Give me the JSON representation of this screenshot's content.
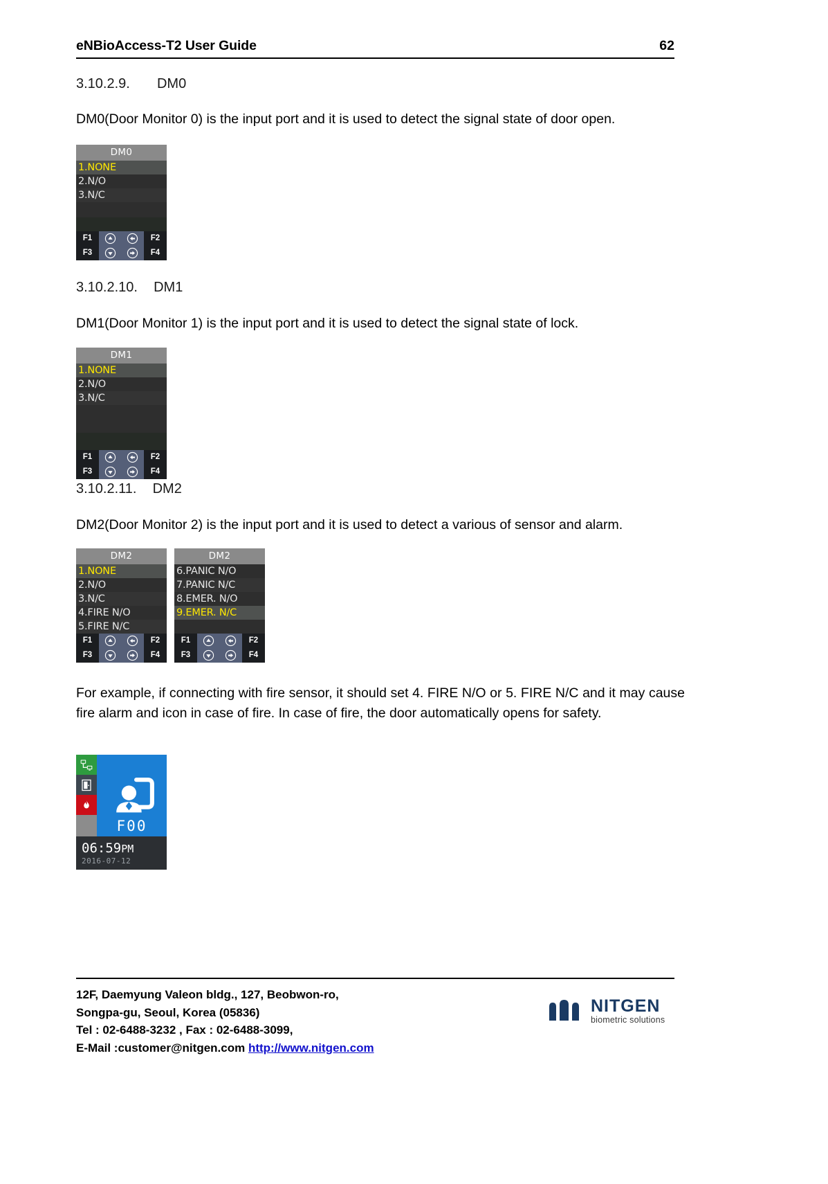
{
  "header": {
    "title": "eNBioAccess-T2 User Guide",
    "page_number": "62"
  },
  "sections": [
    {
      "number": "3.10.2.9.",
      "label": "DM0",
      "paragraph": "DM0(Door Monitor 0) is the input port and it is used to detect the signal state of door open."
    },
    {
      "number": "3.10.2.10.",
      "label": "DM1",
      "paragraph": "DM1(Door Monitor 1) is the input port and it is used to detect the signal state of lock."
    },
    {
      "number": "3.10.2.11.",
      "label": "DM2",
      "paragraph": "DM2(Door Monitor 2) is the input port and it is used to detect a various of sensor and alarm."
    }
  ],
  "example_paragraph": "For example, if connecting with fire sensor, it should set 4. FIRE N/O or 5. FIRE N/C and it may cause fire alarm and icon in case of fire. In case of fire, the door automatically opens for safety.",
  "lcd_screens": {
    "dm0": {
      "title": "DM0",
      "items": [
        "1.NONE",
        "2.N/O",
        "3.N/C"
      ],
      "selected_index": 0
    },
    "dm1": {
      "title": "DM1",
      "items": [
        "1.NONE",
        "2.N/O",
        "3.N/C"
      ],
      "selected_index": 0
    },
    "dm2_left": {
      "title": "DM2",
      "items": [
        "1.NONE",
        "2.N/O",
        "3.N/C",
        "4.FIRE N/O",
        "5.FIRE N/C"
      ],
      "selected_index": 0
    },
    "dm2_right": {
      "title": "DM2",
      "items": [
        "6.PANIC N/O",
        "7.PANIC N/C",
        "8.EMER. N/O",
        "9.EMER. N/C"
      ],
      "selected_index": 3
    }
  },
  "function_keys": {
    "f1": "F1",
    "f2": "F2",
    "f3": "F3",
    "f4": "F4",
    "up_icon": "arrow-up-circle-icon",
    "back_icon": "arrow-back-circle-icon",
    "down_icon": "arrow-down-circle-icon",
    "forward_icon": "arrow-forward-circle-icon"
  },
  "home_screen": {
    "network_icon": "network-icon",
    "door_icon": "door-icon",
    "fire_icon": "fire-alarm-icon",
    "main_icon": "user-access-icon",
    "mode_label": "F00",
    "time": "06:59",
    "ampm": "PM",
    "date": "2016-07-12"
  },
  "footer": {
    "line1": "12F, Daemyung Valeon bldg., 127, Beobwon-ro,",
    "line2": "Songpa-gu, Seoul, Korea (05836)",
    "line3": "Tel : 02-6488-3232 , Fax : 02-6488-3099,",
    "line4_prefix": "E-Mail :customer@nitgen.com ",
    "line4_link": "http://www.nitgen.com",
    "logo_name": "NITGEN",
    "logo_tagline": "biometric solutions"
  },
  "colors": {
    "link": "#1111cc",
    "lcd_selected_text": "#ffe800",
    "lcd_title_bar": "#8a8a8a",
    "home_blue": "#1b7fd4",
    "fire_red": "#cc0e18",
    "network_green": "#2e9b3f",
    "logo_navy": "#1a3a63"
  }
}
